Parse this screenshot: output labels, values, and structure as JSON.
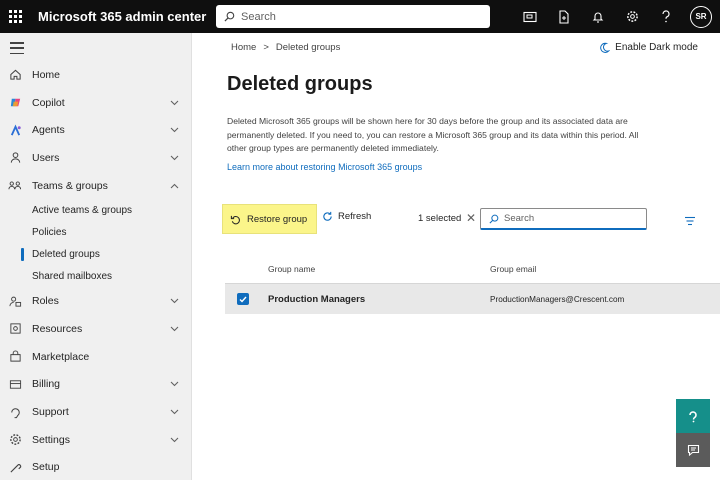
{
  "header": {
    "app_title": "Microsoft 365 admin center",
    "search_placeholder": "Search",
    "icons": [
      "screen-icon",
      "document-icon",
      "bell-icon",
      "gear-icon",
      "help-icon"
    ],
    "avatar_initials": "SR"
  },
  "sidebar": {
    "items": [
      {
        "label": "Home",
        "icon": "home-icon"
      },
      {
        "label": "Copilot",
        "icon": "copilot-icon",
        "expandable": true
      },
      {
        "label": "Agents",
        "icon": "agents-icon",
        "expandable": true
      },
      {
        "label": "Users",
        "icon": "user-icon",
        "expandable": true
      },
      {
        "label": "Teams & groups",
        "icon": "teams-icon",
        "expanded": true
      },
      {
        "label": "Roles",
        "icon": "roles-icon",
        "expandable": true
      },
      {
        "label": "Resources",
        "icon": "resources-icon",
        "expandable": true
      },
      {
        "label": "Marketplace",
        "icon": "marketplace-icon"
      },
      {
        "label": "Billing",
        "icon": "billing-icon",
        "expandable": true
      },
      {
        "label": "Support",
        "icon": "support-icon",
        "expandable": true
      },
      {
        "label": "Settings",
        "icon": "gear-icon",
        "expandable": true
      },
      {
        "label": "Setup",
        "icon": "setup-icon"
      }
    ],
    "teams_subitems": [
      {
        "label": "Active teams & groups"
      },
      {
        "label": "Policies"
      },
      {
        "label": "Deleted groups",
        "active": true
      },
      {
        "label": "Shared mailboxes"
      }
    ]
  },
  "main": {
    "breadcrumb": {
      "home": "Home",
      "separator": ">",
      "current": "Deleted groups"
    },
    "dark_mode_label": "Enable Dark mode",
    "title": "Deleted groups",
    "description": "Deleted Microsoft 365 groups will be shown here for 30 days before the group and its associated data are permanently deleted. If you need to, you can restore a Microsoft 365 group and its data within this period. All other group types are permanently deleted immediately.",
    "learn_more": "Learn more about restoring Microsoft 365 groups",
    "toolbar": {
      "restore_label": "Restore group",
      "refresh_label": "Refresh",
      "selected_text": "1 selected",
      "search_placeholder": "Search"
    },
    "table": {
      "columns": [
        "Group name",
        "Group email"
      ],
      "rows": [
        {
          "name": "Production Managers",
          "email": "ProductionManagers@Crescent.com",
          "selected": true
        }
      ]
    }
  },
  "colors": {
    "topbar": "#0f0f0f",
    "accent": "#0f6cbd",
    "highlight": "#fbf58a",
    "sidebar_bg": "#f0f0f0",
    "float_teal": "#158f8a"
  }
}
